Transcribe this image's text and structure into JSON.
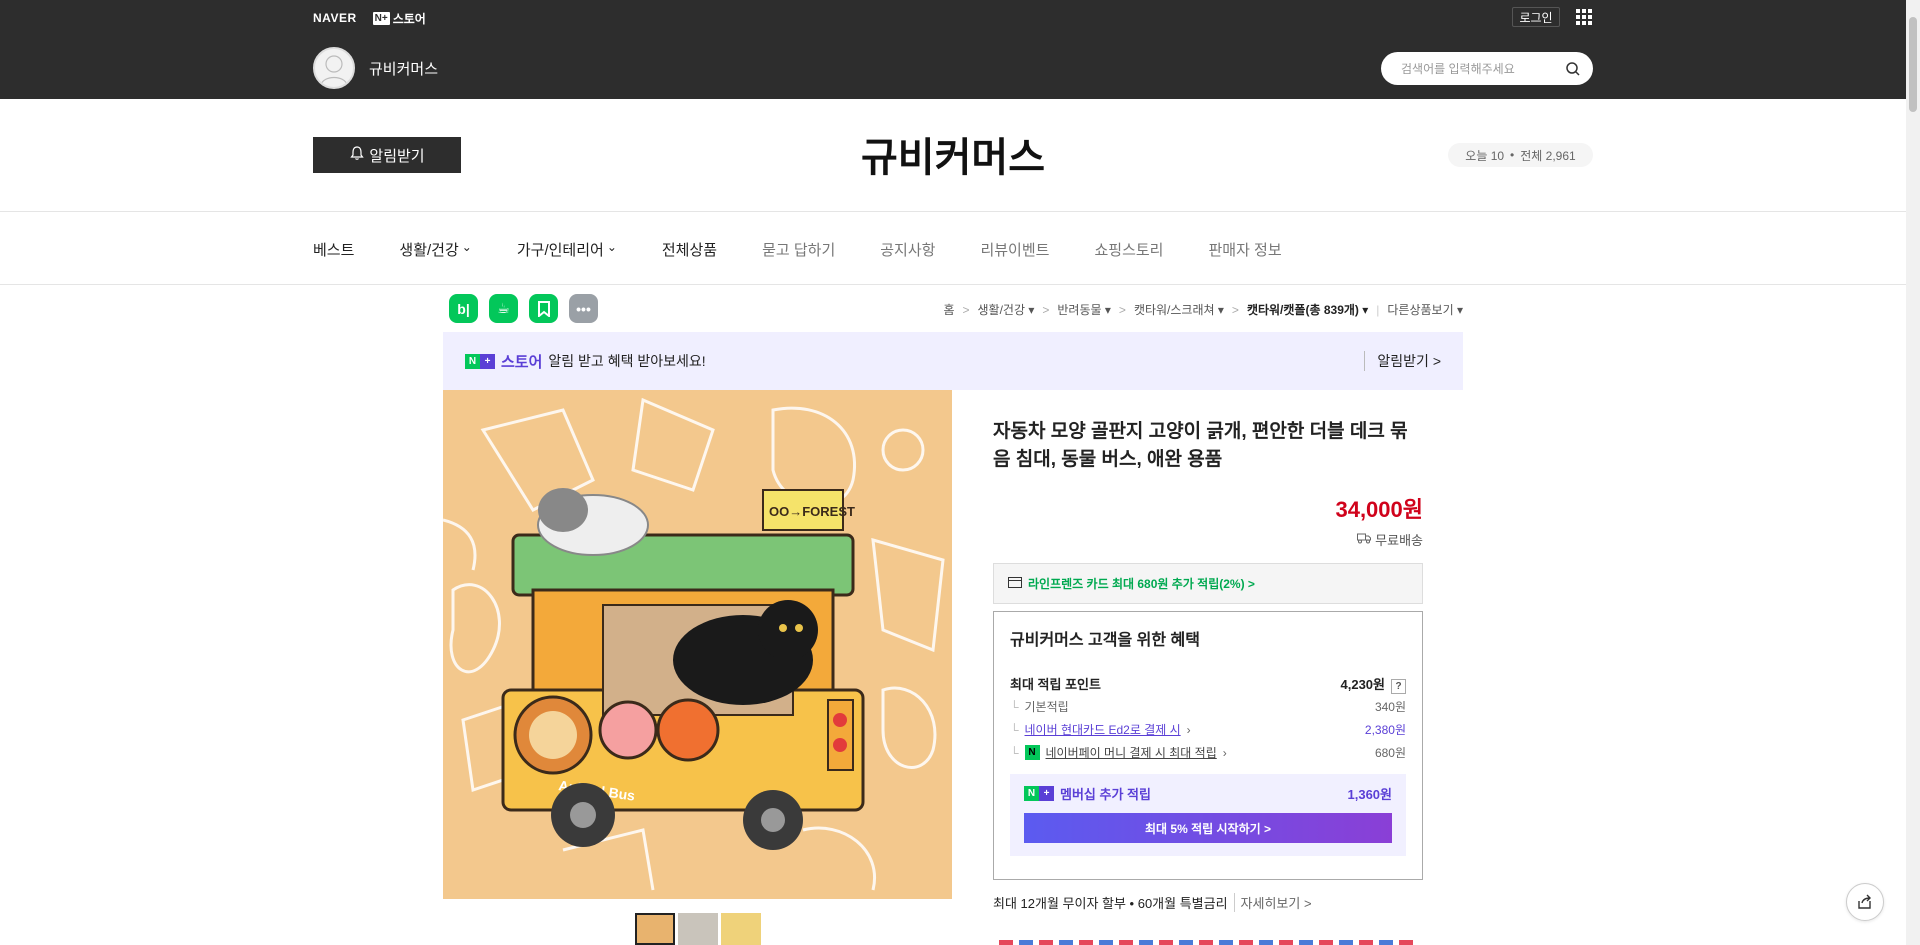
{
  "topbar": {
    "naver_logo": "NAVER",
    "nplus_badge": "N+",
    "store_brand": "스토어",
    "login": "로그인",
    "apps_icon": "grid-icon",
    "store_name": "규비커머스",
    "search_placeholder": "검색어를 입력해주세요"
  },
  "header": {
    "alarm_button": "알림받기",
    "store_title": "규비커머스",
    "visit_today": "오늘 10",
    "visit_total": "전체 2,961"
  },
  "nav": {
    "items": [
      {
        "label": "베스트",
        "dropdown": false
      },
      {
        "label": "생활/건강",
        "dropdown": true
      },
      {
        "label": "가구/인테리어",
        "dropdown": true
      },
      {
        "label": "전체상품",
        "dropdown": false
      },
      {
        "label": "묻고 답하기",
        "dropdown": false
      },
      {
        "label": "공지사항",
        "dropdown": false
      },
      {
        "label": "리뷰이벤트",
        "dropdown": false
      },
      {
        "label": "쇼핑스토리",
        "dropdown": false
      },
      {
        "label": "판매자 정보",
        "dropdown": false
      }
    ]
  },
  "share_icons": [
    {
      "name": "blog-icon",
      "text": "b|",
      "color": "#03c75a"
    },
    {
      "name": "cafe-icon",
      "text": "☕",
      "color": "#03c75a"
    },
    {
      "name": "bookmark-icon",
      "text": "",
      "color": "#03c75a"
    },
    {
      "name": "more-icon",
      "text": "•••",
      "color": "#9aa0a6"
    }
  ],
  "breadcrumb": {
    "home": "홈",
    "c1": "생활/건강",
    "c2": "반려동물",
    "c3": "캣타워/스크래쳐",
    "c4": "캣타워/캣폴(총 839개)",
    "other": "다른상품보기"
  },
  "notice": {
    "nplus": "N+",
    "brand": "스토어",
    "text": "알림 받고 혜택 받아보세요!",
    "action": "알림받기 >"
  },
  "product": {
    "title": "자동차 모양 골판지 고양이 긁개, 편안한 더블 데크 묶음 침대, 동물 버스, 애완 용품",
    "price": "34,000원",
    "shipping": "무료배송",
    "card_promo": "라인프렌즈 카드 최대 680원 추가 적립(2%) >"
  },
  "benefit": {
    "title": "규비커머스 고객을 위한 혜택",
    "max_points_label": "최대 적립 포인트",
    "max_points_value": "4,230원",
    "help": "?",
    "basic_label": "기본적립",
    "basic_value": "340원",
    "card_label": "네이버 현대카드 Ed2로 결제 시",
    "card_value": "2,380원",
    "npay_label": "네이버페이 머니 결제 시 최대 적립",
    "npay_value": "680원",
    "member_label": "멤버십 추가 적립",
    "member_value": "1,360원",
    "start_button": "최대 5% 적립 시작하기 >"
  },
  "installment": {
    "text": "최대 12개월 무이자 할부 • 60개월 특별금리",
    "more": "자세히보기 >"
  },
  "colors": {
    "price_red": "#d0021b",
    "naver_green": "#03c75a",
    "purple": "#5a3fd6",
    "dark_bar": "#2d2d2d"
  }
}
